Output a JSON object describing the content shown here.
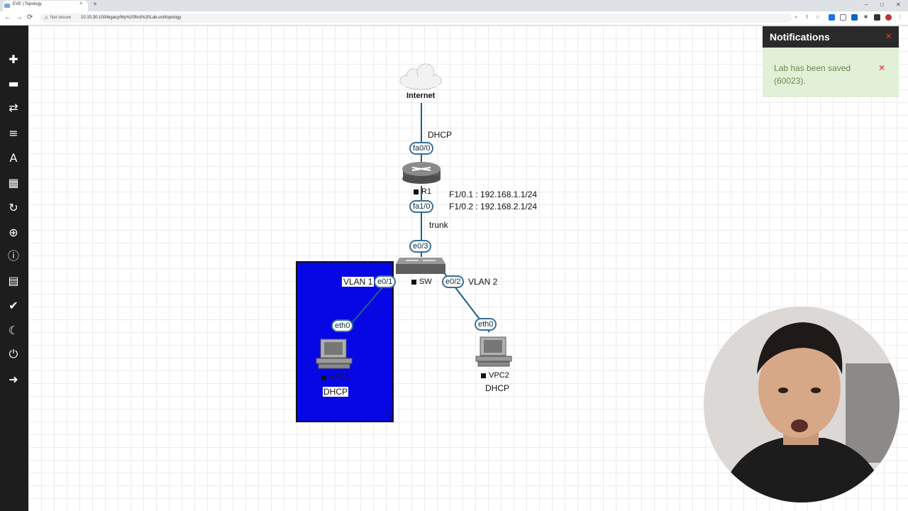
{
  "browser": {
    "tab_title": "EVE | Topology",
    "new_tab": "+",
    "tab_close": "×",
    "security_label": "Not secure",
    "url": "10.10.30.100/legacy/My%20first%20Lab.unl/topology",
    "back": "←",
    "forward": "→",
    "reload": "⟳",
    "minimize": "–",
    "maximize": "□",
    "close": "✕"
  },
  "sidebar": {
    "icons": [
      "add-icon",
      "drive-icon",
      "transfer-icon",
      "list-icon",
      "text-icon",
      "grid-icon",
      "refresh-icon",
      "zoom-icon",
      "info-icon",
      "sheet-icon",
      "check-circle-icon",
      "moon-icon",
      "power-icon",
      "logout-icon"
    ]
  },
  "topology": {
    "nodes": {
      "internet": "Internet",
      "r1": "R1",
      "sw": "SW",
      "vpc1": "VPC1",
      "vpc2": "VPC2"
    },
    "interfaces": {
      "r1_fa00": "fa0/0",
      "r1_fa10": "fa1/0",
      "sw_e03": "e0/3",
      "sw_e01": "e0/1",
      "sw_e02": "e0/2",
      "vpc1_eth0": "eth0",
      "vpc2_eth0": "eth0"
    },
    "annotations": {
      "dhcp_wan": "DHCP",
      "subif1": "F1/0.1 : 192.168.1.1/24",
      "subif2": "F1/0.2 : 192.168.2.1/24",
      "trunk": "trunk",
      "vlan1": "VLAN 1",
      "vlan2": "VLAN 2",
      "vpc1_dhcp": "DHCP",
      "vpc2_dhcp": "DHCP"
    },
    "highlight_color": "#0707e6",
    "link_color": "#1f5f87"
  },
  "notifications": {
    "title": "Notifications",
    "message": "Lab has been saved (60023).",
    "close": "×",
    "dismiss": "×"
  }
}
